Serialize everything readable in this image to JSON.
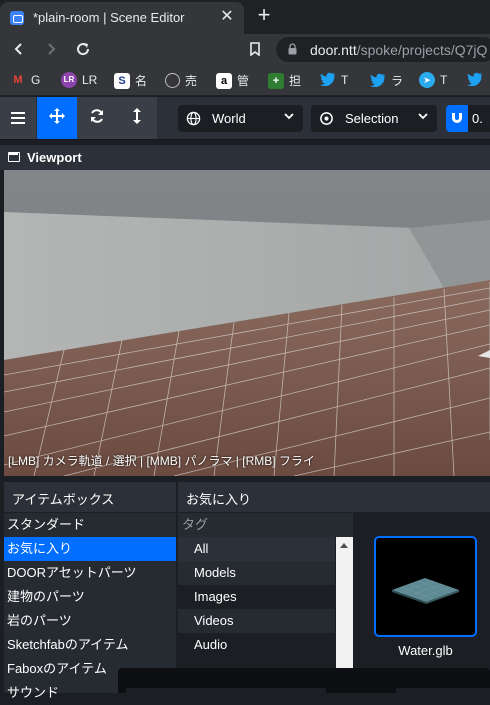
{
  "browser": {
    "tab_title": "*plain-room | Scene Editor",
    "close_glyph": "✕",
    "newtab_glyph": "+",
    "url_host": "door.ntt",
    "url_path": "/spoke/projects/Q7jQ"
  },
  "bookmarks": [
    {
      "icon": "gmail-icon",
      "glyph": "M",
      "label": "G",
      "color": "#ea4335"
    },
    {
      "icon": "lr-icon",
      "glyph": "LR",
      "label": "LR",
      "color": "#8e44ad"
    },
    {
      "icon": "s-icon",
      "glyph": "S",
      "label": "名",
      "color": "#ffffff"
    },
    {
      "icon": "globe-icon",
      "glyph": "◍",
      "label": "売",
      "color": "#bdbdbd"
    },
    {
      "icon": "amazon-icon",
      "glyph": "a",
      "label": "管",
      "color": "#000000"
    },
    {
      "icon": "plus-green-icon",
      "glyph": "+",
      "label": "担",
      "color": "#2e7d32"
    },
    {
      "icon": "twitter-icon",
      "glyph": "🐦",
      "label": "T",
      "color": "#1da1f2"
    },
    {
      "icon": "twitter-icon-2",
      "glyph": "🐦",
      "label": "ラ",
      "color": "#1da1f2"
    },
    {
      "icon": "telegram-icon",
      "glyph": "➤",
      "label": "T",
      "color": "#2aabee"
    },
    {
      "icon": "twitter-icon-3",
      "glyph": "🐦",
      "label": "",
      "color": "#1da1f2"
    }
  ],
  "editor_toolbar": {
    "space_dropdown": "World",
    "pivot_dropdown": "Selection",
    "snap_value": "0."
  },
  "viewport": {
    "title": "Viewport",
    "help_text": "[LMB] カメラ軌道 / 選択 | [MMB] パノラマ | [RMB] フライ"
  },
  "assets": {
    "left_header": "アイテムボックス",
    "right_header": "お気に入り",
    "sources": [
      "スタンダード",
      "お気に入り",
      "DOORアセットパーツ",
      "建物のパーツ",
      "岩のパーツ",
      "Sketchfabのアイテム",
      "Faboxのアイテム",
      "サウンド"
    ],
    "selected_source_index": 1,
    "tags_header": "タグ",
    "tags": [
      "All",
      "Models",
      "Images",
      "Videos",
      "Audio"
    ],
    "result_label": "Water.glb"
  },
  "colors": {
    "accent": "#006eff",
    "panel": "#2c3038",
    "background": "#1b1e23"
  }
}
